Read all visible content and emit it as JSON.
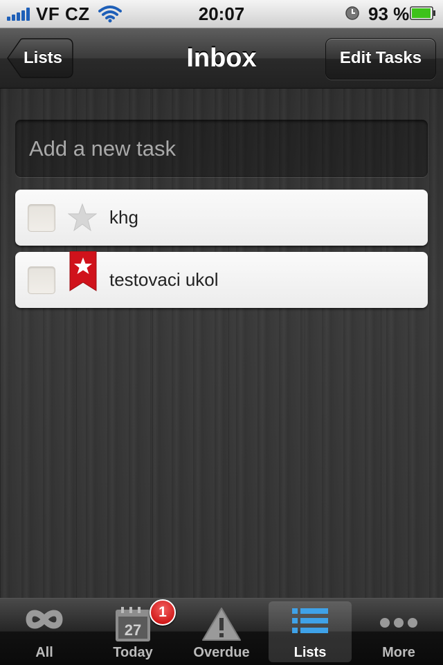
{
  "status_bar": {
    "carrier": "VF CZ",
    "time": "20:07",
    "battery_percent": "93 %",
    "signal_bars": 5,
    "battery_level": 0.93
  },
  "nav": {
    "back_label": "Lists",
    "title": "Inbox",
    "edit_label": "Edit Tasks"
  },
  "add_task": {
    "placeholder": "Add a new task"
  },
  "tasks": [
    {
      "title": "khg",
      "completed": false,
      "starred": false
    },
    {
      "title": "testovaci ukol",
      "completed": false,
      "starred": true
    }
  ],
  "tabs": [
    {
      "label": "All",
      "icon": "infinity-icon",
      "active": false
    },
    {
      "label": "Today",
      "icon": "calendar-icon",
      "active": false,
      "calendar_day": "27",
      "badge": "1"
    },
    {
      "label": "Overdue",
      "icon": "warning-icon",
      "active": false
    },
    {
      "label": "Lists",
      "icon": "list-icon",
      "active": true
    },
    {
      "label": "More",
      "icon": "more-dots-icon",
      "active": false
    }
  ],
  "colors": {
    "accent_blue": "#3fa2e8",
    "star_red": "#d0121b",
    "badge_red": "#d40000",
    "battery_green": "#3ec21a"
  }
}
